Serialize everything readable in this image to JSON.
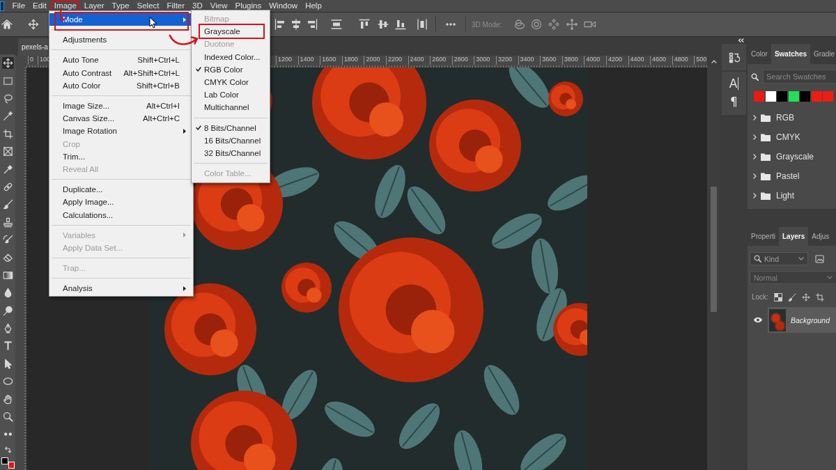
{
  "menu_bar": {
    "items": [
      {
        "label": "File",
        "marked": false
      },
      {
        "label": "Edit",
        "marked": false
      },
      {
        "label": "Image",
        "marked": true
      },
      {
        "label": "Layer",
        "marked": false
      },
      {
        "label": "Type",
        "marked": false
      },
      {
        "label": "Select",
        "marked": false
      },
      {
        "label": "Filter",
        "marked": false
      },
      {
        "label": "3D",
        "marked": false
      },
      {
        "label": "View",
        "marked": false
      },
      {
        "label": "Plugins",
        "marked": false
      },
      {
        "label": "Window",
        "marked": false
      },
      {
        "label": "Help",
        "marked": false
      }
    ]
  },
  "options_bar": {
    "mode_label": "3D Mode:"
  },
  "tools": [
    {
      "kind": "move",
      "selected": true
    },
    {
      "kind": "marquee",
      "selected": false
    },
    {
      "kind": "lasso",
      "selected": false
    },
    {
      "kind": "wand",
      "selected": false
    },
    {
      "kind": "crop",
      "selected": false
    },
    {
      "kind": "frame",
      "selected": false
    },
    {
      "kind": "eyedropper",
      "selected": false
    },
    {
      "kind": "healing",
      "selected": false
    },
    {
      "kind": "brush",
      "selected": false
    },
    {
      "kind": "stamp",
      "selected": false
    },
    {
      "kind": "history",
      "selected": false
    },
    {
      "kind": "eraser",
      "selected": false
    },
    {
      "kind": "gradient",
      "selected": false
    },
    {
      "kind": "blur",
      "selected": false
    },
    {
      "kind": "dodge",
      "selected": false
    },
    {
      "kind": "pen",
      "selected": false
    },
    {
      "kind": "type",
      "selected": false
    },
    {
      "kind": "path",
      "selected": false
    },
    {
      "kind": "ellipse",
      "selected": false
    },
    {
      "kind": "hand",
      "selected": false
    },
    {
      "kind": "zoom",
      "selected": false
    },
    {
      "kind": "more",
      "selected": false
    }
  ],
  "color_chips": [
    {
      "color": "#000000"
    },
    {
      "color": "#e5150c"
    }
  ],
  "document_tab": {
    "title": "pexels-a"
  },
  "ruler": {
    "left_labels": [
      "0",
      "100"
    ],
    "labels": [
      "1200",
      "1400",
      "1600",
      "1800",
      "2000",
      "2200",
      "2400",
      "2600",
      "2800",
      "3000",
      "3200",
      "3400",
      "3600",
      "3800",
      "4000",
      "4200",
      "4400",
      "4600",
      "4800",
      "500"
    ]
  },
  "image_menu": {
    "groups": [
      [
        {
          "label": "Mode",
          "selected": true,
          "disabled": false,
          "has_submenu": true,
          "marked": true
        }
      ],
      [
        {
          "label": "Adjustments",
          "selected": false,
          "disabled": false,
          "has_submenu": false,
          "marked": false
        }
      ],
      [
        {
          "label": "Auto Tone",
          "shortcut": "Shift+Ctrl+L",
          "selected": false,
          "disabled": false,
          "has_submenu": false,
          "marked": false
        },
        {
          "label": "Auto Contrast",
          "shortcut": "Alt+Shift+Ctrl+L",
          "selected": false,
          "disabled": false,
          "has_submenu": false,
          "marked": false
        },
        {
          "label": "Auto Color",
          "shortcut": "Shift+Ctrl+B",
          "selected": false,
          "disabled": false,
          "has_submenu": false,
          "marked": false
        }
      ],
      [
        {
          "label": "Image Size...",
          "shortcut": "Alt+Ctrl+I",
          "selected": false,
          "disabled": false,
          "has_submenu": false,
          "marked": false
        },
        {
          "label": "Canvas Size...",
          "shortcut": "Alt+Ctrl+C",
          "selected": false,
          "disabled": false,
          "has_submenu": false,
          "marked": false
        },
        {
          "label": "Image Rotation",
          "selected": false,
          "disabled": false,
          "has_submenu": true,
          "marked": false
        },
        {
          "label": "Crop",
          "selected": false,
          "disabled": true,
          "has_submenu": false,
          "marked": false
        },
        {
          "label": "Trim...",
          "selected": false,
          "disabled": false,
          "has_submenu": false,
          "marked": false
        },
        {
          "label": "Reveal All",
          "selected": false,
          "disabled": true,
          "has_submenu": false,
          "marked": false
        }
      ],
      [
        {
          "label": "Duplicate...",
          "selected": false,
          "disabled": false,
          "has_submenu": false,
          "marked": false
        },
        {
          "label": "Apply Image...",
          "selected": false,
          "disabled": false,
          "has_submenu": false,
          "marked": false
        },
        {
          "label": "Calculations...",
          "selected": false,
          "disabled": false,
          "has_submenu": false,
          "marked": false
        }
      ],
      [
        {
          "label": "Variables",
          "selected": false,
          "disabled": true,
          "has_submenu": true,
          "marked": false
        },
        {
          "label": "Apply Data Set...",
          "selected": false,
          "disabled": true,
          "has_submenu": false,
          "marked": false
        }
      ],
      [
        {
          "label": "Trap...",
          "selected": false,
          "disabled": true,
          "has_submenu": false,
          "marked": false
        }
      ],
      [
        {
          "label": "Analysis",
          "selected": false,
          "disabled": false,
          "has_submenu": true,
          "marked": false
        }
      ]
    ]
  },
  "mode_submenu": {
    "groups": [
      [
        {
          "label": "Bitmap",
          "disabled": true,
          "checked": false,
          "marked": false
        },
        {
          "label": "Grayscale",
          "disabled": false,
          "checked": false,
          "marked": true
        },
        {
          "label": "Duotone",
          "disabled": true,
          "checked": false,
          "marked": false
        },
        {
          "label": "Indexed Color...",
          "disabled": false,
          "checked": false,
          "marked": false
        },
        {
          "label": "RGB Color",
          "disabled": false,
          "checked": true,
          "marked": false
        },
        {
          "label": "CMYK Color",
          "disabled": false,
          "checked": false,
          "marked": false
        },
        {
          "label": "Lab Color",
          "disabled": false,
          "checked": false,
          "marked": false
        },
        {
          "label": "Multichannel",
          "disabled": false,
          "checked": false,
          "marked": false
        }
      ],
      [
        {
          "label": "8 Bits/Channel",
          "disabled": false,
          "checked": true,
          "marked": false
        },
        {
          "label": "16 Bits/Channel",
          "disabled": false,
          "checked": false,
          "marked": false
        },
        {
          "label": "32 Bits/Channel",
          "disabled": false,
          "checked": false,
          "marked": false
        }
      ],
      [
        {
          "label": "Color Table...",
          "disabled": true,
          "checked": false,
          "marked": false
        }
      ]
    ]
  },
  "side_panel_icons": [
    {
      "kind": "history"
    },
    {
      "kind": "character",
      "glyph": "A"
    },
    {
      "kind": "paragraph",
      "glyph": "¶"
    }
  ],
  "swatches_panel": {
    "tabs": [
      {
        "label": "Color",
        "selected": false
      },
      {
        "label": "Swatches",
        "selected": true
      },
      {
        "label": "Gradie",
        "selected": false
      }
    ],
    "search": {
      "placeholder": "Search Swatches"
    },
    "swatches": [
      {
        "color": "#ea1a12"
      },
      {
        "color": "#ffffff"
      },
      {
        "color": "#000000"
      },
      {
        "color": "#22e055"
      },
      {
        "color": "#000000"
      },
      {
        "color": "#f01c10"
      },
      {
        "color": "#f01c10"
      }
    ],
    "groups": [
      {
        "name": "RGB",
        "expanded": false
      },
      {
        "name": "CMYK",
        "expanded": false
      },
      {
        "name": "Grayscale",
        "expanded": false
      },
      {
        "name": "Pastel",
        "expanded": false
      },
      {
        "name": "Light",
        "expanded": false
      }
    ]
  },
  "layers_panel": {
    "tabs": [
      {
        "label": "Properti",
        "selected": false
      },
      {
        "label": "Layers",
        "selected": true
      },
      {
        "label": "Adjus",
        "selected": false
      }
    ],
    "filter": {
      "value": "Kind"
    },
    "blend_mode": {
      "value": "Normal",
      "disabled": true
    },
    "lock_label": "Lock:",
    "layers": [
      {
        "name": "Background",
        "visible": true,
        "selected": true
      }
    ]
  }
}
